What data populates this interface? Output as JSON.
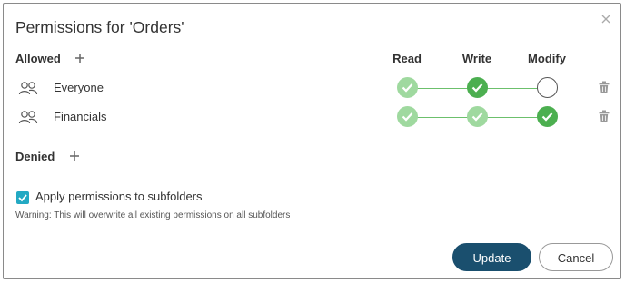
{
  "dialog": {
    "title": "Permissions for 'Orders'",
    "close_icon": "close-icon"
  },
  "allowed": {
    "label": "Allowed",
    "add_icon": "plus-icon"
  },
  "columns": [
    "Read",
    "Write",
    "Modify"
  ],
  "rows": [
    {
      "icon": "group-users-icon",
      "label": "Everyone",
      "states": [
        "light",
        "dark",
        "empty"
      ]
    },
    {
      "icon": "group-users-icon",
      "label": "Financials",
      "states": [
        "light",
        "light",
        "dark"
      ]
    }
  ],
  "denied": {
    "label": "Denied",
    "add_icon": "plus-icon"
  },
  "subfolders": {
    "checked": true,
    "label": "Apply permissions to subfolders",
    "warning": "Warning: This will overwrite all existing permissions on all subfolders"
  },
  "buttons": {
    "update": "Update",
    "cancel": "Cancel"
  },
  "colors": {
    "green_light": "#9fd99f",
    "green_dark": "#4caf50",
    "accent_teal": "#23a9c3",
    "primary_button": "#1a4f6e"
  }
}
